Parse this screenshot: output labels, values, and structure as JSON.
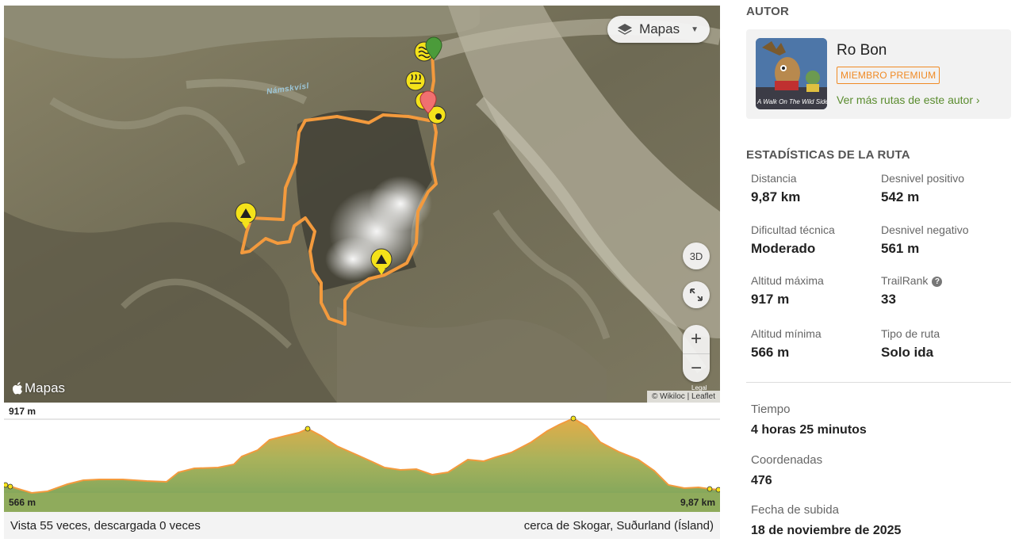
{
  "map": {
    "layers_button": "Mapas",
    "btn_3d": "3D",
    "zoom_in": "+",
    "zoom_out": "−",
    "brand": "Mapas",
    "attribution_wikiloc": "© Wikiloc",
    "attribution_leaflet": "Leaflet",
    "legal": "Legal",
    "river_label": "Námskvísl",
    "icons": [
      "layers-icon",
      "expand-icon",
      "apple-icon",
      "start-marker-icon",
      "end-marker-icon",
      "summit-waypoint-icon",
      "hot-spring-waypoint-icon",
      "water-waypoint-icon"
    ],
    "route_color": "#f39a3d"
  },
  "elevation": {
    "max_label": "917 m",
    "min_label": "566 m",
    "distance_label": "9,87 km",
    "fill_color": "#8fab5c"
  },
  "footer": {
    "views": "Vista 55 veces, descargada 0 veces",
    "location": "cerca de Skogar, Suðurland (Ísland)"
  },
  "author": {
    "section_title": "AUTOR",
    "name": "Ro Bon",
    "badge": "MIEMBRO PREMIUM",
    "link": "Ver más rutas de este autor ›",
    "avatar_caption": "A Walk On The Wild Side"
  },
  "stats": {
    "section_title": "ESTADÍSTICAS DE LA RUTA",
    "items": [
      {
        "label": "Distancia",
        "value": "9,87 km"
      },
      {
        "label": "Desnivel positivo",
        "value": "542 m"
      },
      {
        "label": "Dificultad técnica",
        "value": "Moderado"
      },
      {
        "label": "Desnivel negativo",
        "value": "561 m"
      },
      {
        "label": "Altitud máxima",
        "value": "917 m"
      },
      {
        "label": "TrailRank",
        "value": "33"
      },
      {
        "label": "Altitud mínima",
        "value": "566 m"
      },
      {
        "label": "Tipo de ruta",
        "value": "Solo ida"
      }
    ],
    "help_icon": "?"
  },
  "info": [
    {
      "label": "Tiempo",
      "value": "4 horas 25 minutos"
    },
    {
      "label": "Coordenadas",
      "value": "476"
    },
    {
      "label": "Fecha de subida",
      "value": "18 de noviembre de 2025"
    }
  ]
}
